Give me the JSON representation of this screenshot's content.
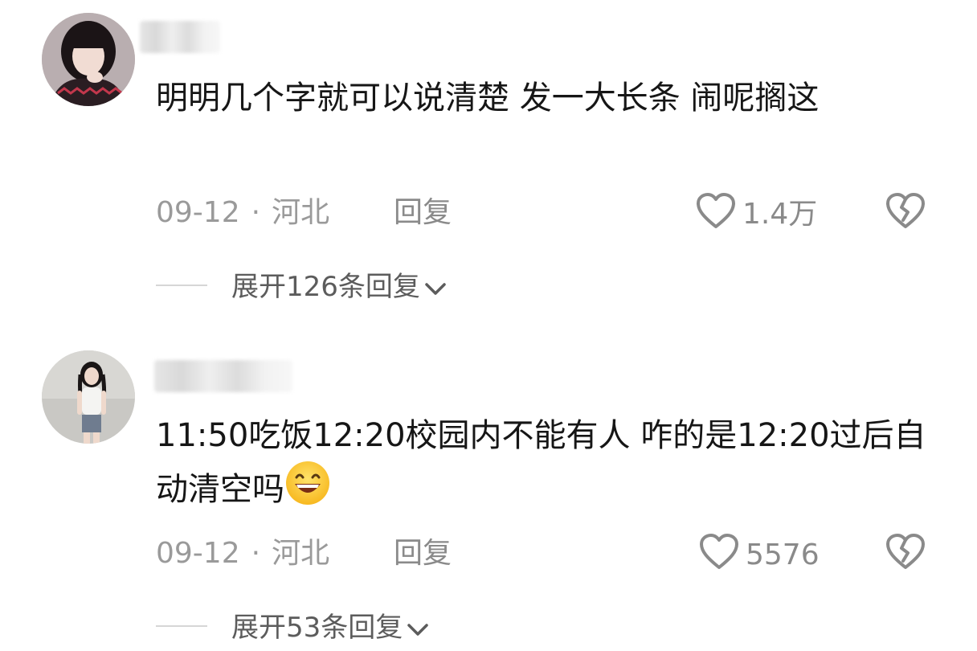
{
  "comments": [
    {
      "text": "明明几个字就可以说清楚 发一大长条 闹呢搁这",
      "date": "09-12",
      "location": "河北",
      "reply_label": "回复",
      "likes": "1.4万",
      "expand_label": "展开126条回复",
      "avatar_icon": "user-avatar-icon",
      "like_icon": "heart-outline-icon",
      "dislike_icon": "broken-heart-icon",
      "expand_icon": "chevron-down-icon"
    },
    {
      "text": "11:50吃饭12:20校园内不能有人 咋的是12:20过后自动清空吗",
      "emoji": "grinning-face-emoji",
      "date": "09-12",
      "location": "河北",
      "reply_label": "回复",
      "likes": "5576",
      "expand_label": "展开53条回复",
      "avatar_icon": "user-avatar-icon",
      "like_icon": "heart-outline-icon",
      "dislike_icon": "broken-heart-icon",
      "expand_icon": "chevron-down-icon"
    }
  ],
  "separator": "·",
  "colors": {
    "primary_text": "#161616",
    "secondary_text": "#9a9a9a",
    "action_text": "#8a8a8a"
  }
}
